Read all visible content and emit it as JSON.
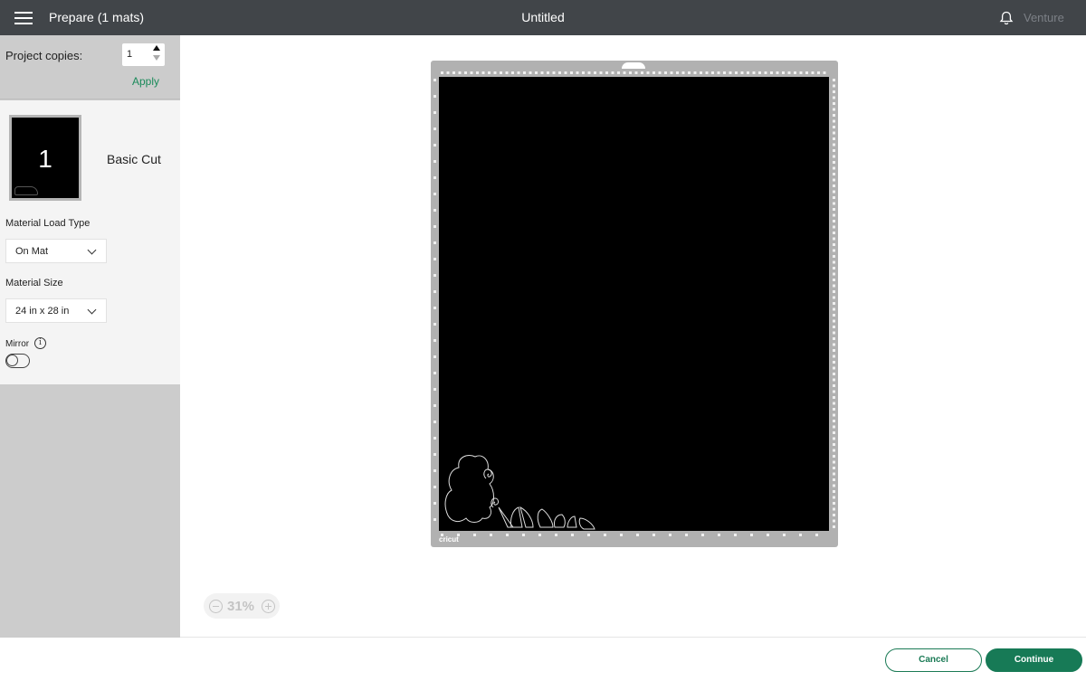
{
  "header": {
    "menu_icon": "hamburger-menu-icon",
    "title": "Prepare (1 mats)",
    "document_title": "Untitled",
    "notification_icon": "bell-icon",
    "machine_name": "Venture"
  },
  "sidebar": {
    "project_copies": {
      "label": "Project copies:",
      "value": "1",
      "apply_label": "Apply"
    },
    "mats": [
      {
        "number": "1",
        "name": "Basic Cut"
      }
    ],
    "material_load_type": {
      "label": "Material Load Type",
      "selected": "On Mat"
    },
    "material_size": {
      "label": "Material Size",
      "selected": "24 in x 28 in"
    },
    "mirror": {
      "label": "Mirror",
      "info_icon": "info-icon",
      "enabled": false
    }
  },
  "canvas": {
    "mat_brand": "cricut",
    "zoom_level": "31%"
  },
  "footer": {
    "cancel_label": "Cancel",
    "continue_label": "Continue"
  },
  "colors": {
    "topbar": "#414549",
    "accent_green": "#177a56",
    "mat_frame": "#b1b1b1",
    "sidebar_gray": "#cccccc"
  }
}
